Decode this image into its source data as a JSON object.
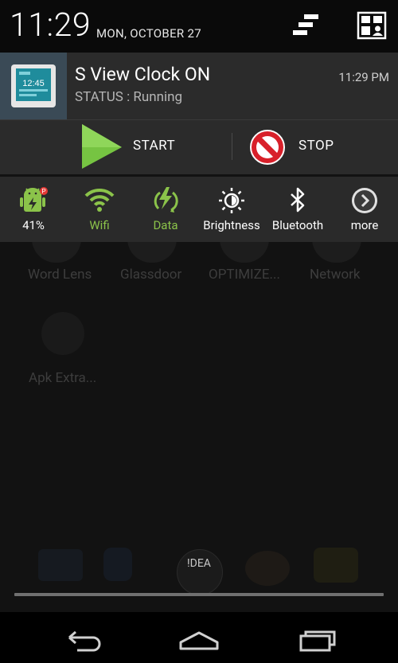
{
  "statusbar": {
    "time": "11:29",
    "date": "MON, OCTOBER 27"
  },
  "notification": {
    "icon_name": "clock-app-icon",
    "title": "S View Clock ON",
    "status": "STATUS : Running",
    "time": "11:29 PM",
    "actions": [
      {
        "label": "START",
        "icon": "play-icon",
        "color": "#76c442"
      },
      {
        "label": "STOP",
        "icon": "stop-icon",
        "color": "#d8202a"
      }
    ]
  },
  "quick_settings": [
    {
      "label": "41%",
      "icon": "battery-android-icon",
      "active": false
    },
    {
      "label": "Wifi",
      "icon": "wifi-icon",
      "active": true
    },
    {
      "label": "Data",
      "icon": "data-icon",
      "active": true
    },
    {
      "label": "Brightness",
      "icon": "brightness-icon",
      "active": false
    },
    {
      "label": "Bluetooth",
      "icon": "bluetooth-icon",
      "active": false
    },
    {
      "label": "more",
      "icon": "chevron-right-icon",
      "active": false
    }
  ],
  "background": {
    "labels": [
      "Word Lens",
      "Glassdoor",
      "OPTIMIZE...",
      "Network",
      "Apk Extra..."
    ],
    "dock_label": "!DEA"
  },
  "colors": {
    "accent_green": "#8bc34a",
    "shade_bg": "#2b2b2b",
    "header_bg": "#0a0a0a"
  }
}
